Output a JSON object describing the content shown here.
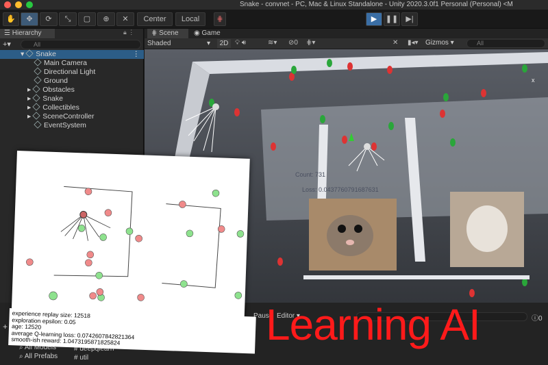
{
  "window": {
    "title": "Snake - convnet - PC, Mac & Linux Standalone - Unity 2020.3.0f1 Personal (Personal) <M"
  },
  "toolbar": {
    "center": "Center",
    "local": "Local"
  },
  "hierarchy": {
    "tab": "Hierarchy",
    "search_placeholder": "All",
    "root": "Snake",
    "items": [
      "Main Camera",
      "Directional Light",
      "Ground",
      "Obstacles",
      "Snake",
      "Collectibles",
      "SceneController",
      "EventSystem"
    ]
  },
  "scene": {
    "tab_scene": "Scene",
    "tab_game": "Game",
    "shading": "Shaded",
    "mode_2d": "2D",
    "fx_count": "0",
    "gizmos": "Gizmos",
    "search_placeholder": "All",
    "count_label": "Count: 731",
    "loss_label": "Loss: 0.0437760791687631"
  },
  "bottom": {
    "pause_label": "Pause",
    "editor_label": "Editor",
    "count_badge": "0",
    "all_models": "All Models",
    "all_prefabs": "All Prefabs",
    "files": [
      "deepqlearn",
      "util"
    ]
  },
  "stats": {
    "line1": "experience replay size: 12518",
    "line2": "exploration epsilon: 0.05",
    "line3": "age: 12520",
    "line4": "average Q-learning loss: 0.0742607842821364",
    "line5": "smooth-ish reward: 1.0473195871825824"
  },
  "overlay": {
    "caption": "Learning AI"
  },
  "colors": {
    "red_text": "#ff1a1a",
    "play_blue": "#3a6ea5",
    "hierarchy_select": "#2c5d87"
  }
}
